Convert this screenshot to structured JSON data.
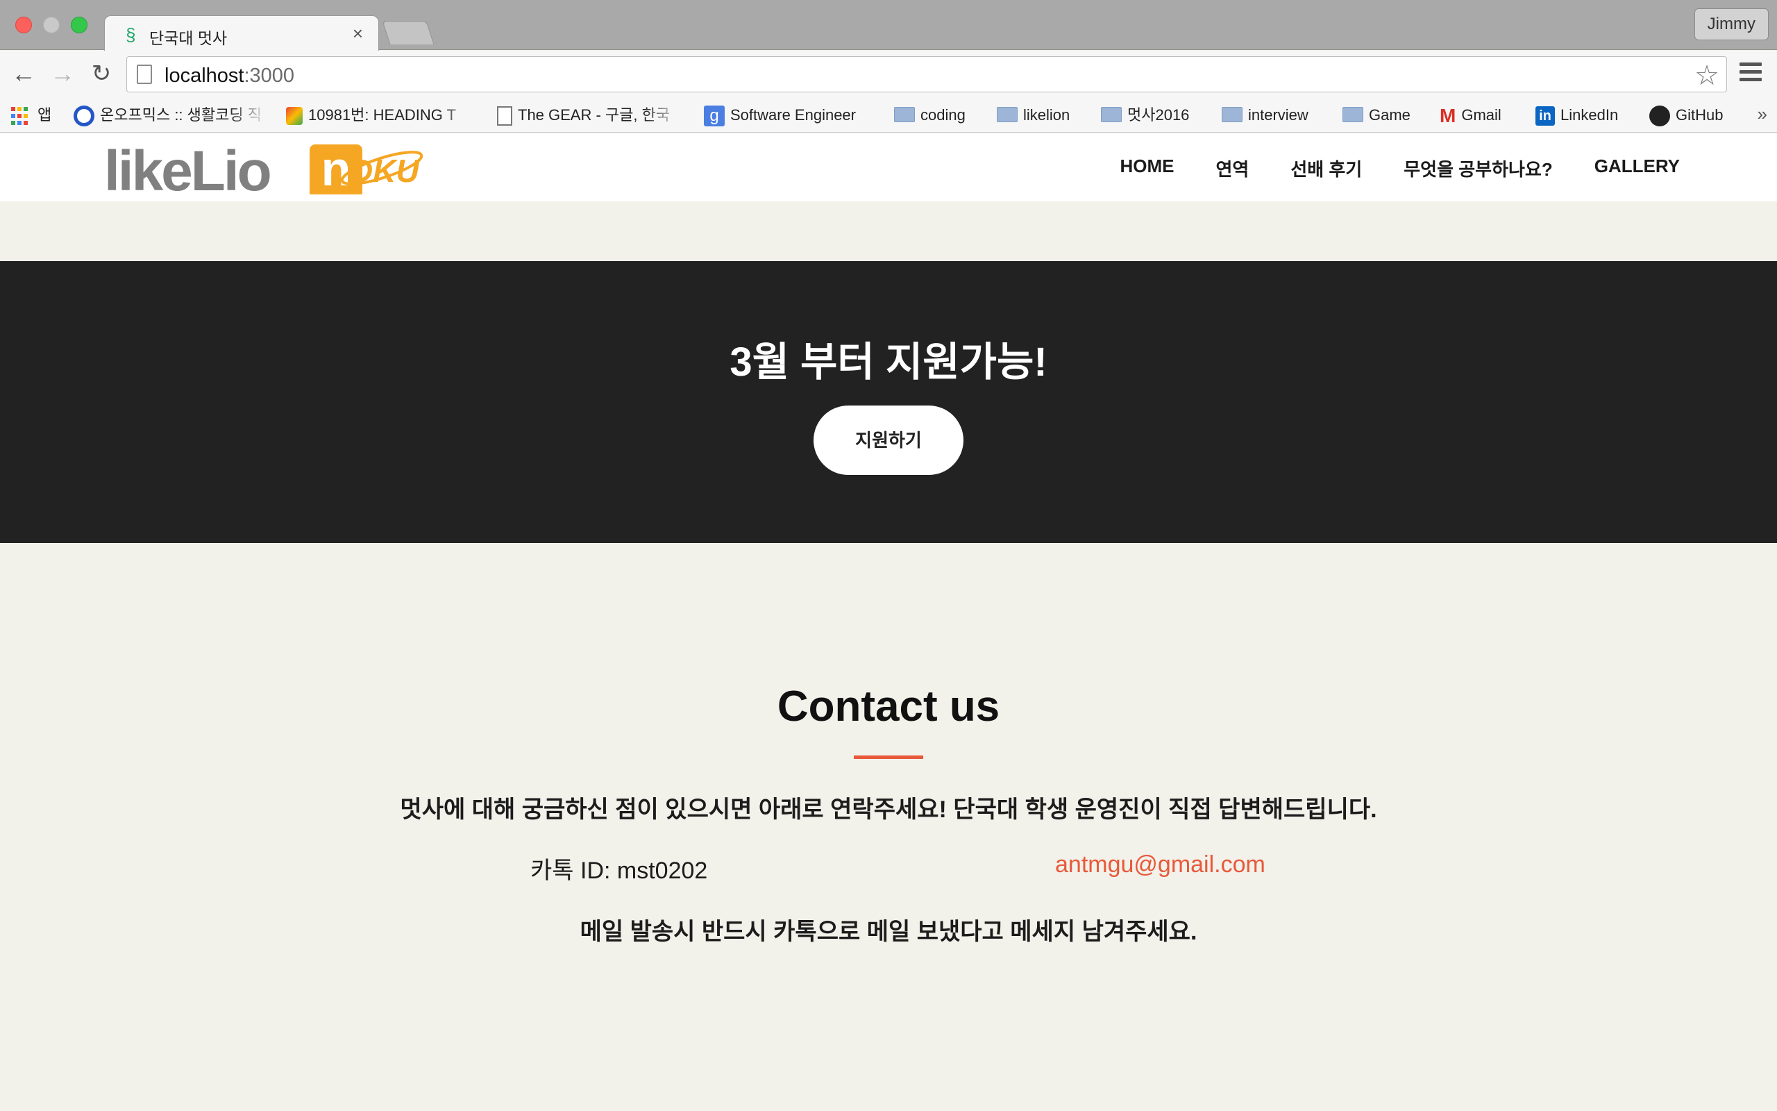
{
  "browser": {
    "tab": {
      "title": "단국대 멋사",
      "close_glyph": "×"
    },
    "profile_name": "Jimmy",
    "url_host": "localhost",
    "url_port": ":3000",
    "bookmarks": [
      {
        "label": "앱",
        "icon": "apps-grid-icon"
      },
      {
        "label": "온오프믹스 :: 생활코딩 직",
        "icon": "onoffmix-icon"
      },
      {
        "label": "10981번: HEADING T",
        "icon": "acmicpc-icon"
      },
      {
        "label": "The GEAR - 구글, 한국",
        "icon": "page-icon"
      },
      {
        "label": "Software Engineer",
        "icon": "google-icon"
      },
      {
        "label": "coding",
        "icon": "folder-icon"
      },
      {
        "label": "likelion",
        "icon": "folder-icon"
      },
      {
        "label": "멋사2016",
        "icon": "folder-icon"
      },
      {
        "label": "interview",
        "icon": "folder-icon"
      },
      {
        "label": "Game",
        "icon": "folder-icon"
      },
      {
        "label": "Gmail",
        "icon": "gmail-icon"
      },
      {
        "label": "LinkedIn",
        "icon": "linkedin-icon"
      },
      {
        "label": "GitHub",
        "icon": "github-icon"
      }
    ],
    "more_glyph": "»"
  },
  "site": {
    "logo_text": "likeLion",
    "logo_sub": "DKU",
    "nav": [
      "HOME",
      "연역",
      "선배 후기",
      "무엇을 공부하나요?",
      "GALLERY"
    ],
    "cta": {
      "title": "3월 부터 지원가능!",
      "button": "지원하기"
    },
    "contact": {
      "title": "Contact us",
      "description": "멋사에 대해 궁금하신 점이 있으시면 아래로 연락주세요! 단국대 학생 운영진이 직접 답변해드립니다.",
      "kakao": "카톡 ID: mst0202",
      "email": "antmgu@gmail.com",
      "note": "메일 발송시 반드시 카톡으로 메일 보냈다고 메세지 남겨주세요."
    }
  },
  "colors": {
    "accent": "#e8593a",
    "cta_bg": "#222222",
    "page_bg": "#f2f1ea",
    "logo_orange": "#f5a623"
  }
}
